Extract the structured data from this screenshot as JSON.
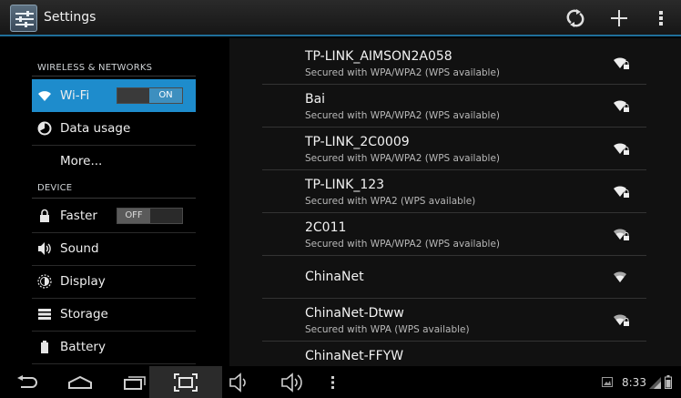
{
  "app": {
    "title": "Settings"
  },
  "left": {
    "categories": [
      "WIRELESS & NETWORKS",
      "DEVICE"
    ],
    "items": [
      {
        "label": "Wi-Fi",
        "icon": "wifi-icon",
        "toggle": "ON",
        "selected": true
      },
      {
        "label": "Data usage",
        "icon": "data-usage-icon"
      },
      {
        "label": "More..."
      },
      {
        "label": "Faster",
        "icon": "lock-icon",
        "toggle": "OFF"
      },
      {
        "label": "Sound",
        "icon": "sound-icon"
      },
      {
        "label": "Display",
        "icon": "display-icon"
      },
      {
        "label": "Storage",
        "icon": "storage-icon"
      },
      {
        "label": "Battery",
        "icon": "battery-icon"
      }
    ]
  },
  "networks": [
    {
      "ssid": "TP-LINK_AIMSON2A058",
      "security": "Secured with WPA/WPA2 (WPS available)"
    },
    {
      "ssid": "Bai",
      "security": "Secured with WPA/WPA2 (WPS available)"
    },
    {
      "ssid": "TP-LINK_2C0009",
      "security": "Secured with WPA/WPA2 (WPS available)"
    },
    {
      "ssid": "TP-LINK_123",
      "security": "Secured with WPA2 (WPS available)"
    },
    {
      "ssid": "2C011",
      "security": "Secured with WPA/WPA2 (WPS available)"
    },
    {
      "ssid": "ChinaNet",
      "security": ""
    },
    {
      "ssid": "ChinaNet-Dtww",
      "security": "Secured with WPA (WPS available)"
    },
    {
      "ssid": "ChinaNet-FFYW",
      "security": ""
    }
  ],
  "status": {
    "time": "8:33"
  },
  "colors": {
    "accent": "#1e8ccc",
    "actionbar_line": "#1f6f9a"
  }
}
